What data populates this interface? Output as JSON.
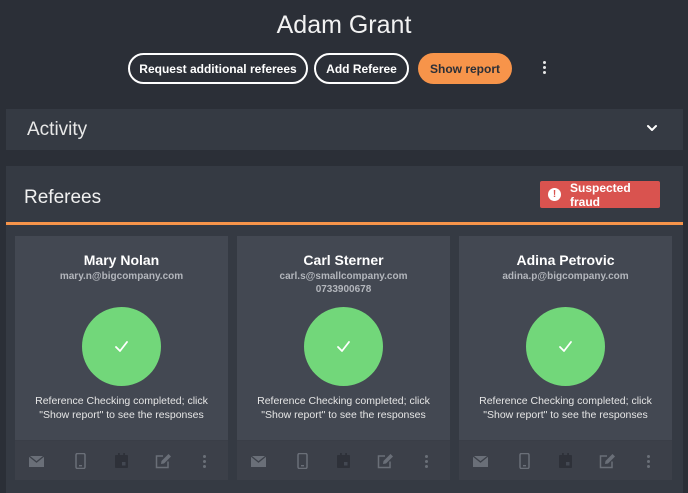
{
  "header": {
    "title": "Adam Grant",
    "buttons": {
      "request_label": "Request additional referees",
      "add_label": "Add Referee",
      "show_label": "Show report"
    },
    "more_icon": "more-vertical-icon"
  },
  "activity": {
    "title": "Activity",
    "toggle_icon": "chevron-down-icon"
  },
  "referees": {
    "title": "Referees",
    "badge": {
      "label": "Suspected fraud",
      "icon": "alert-circle-icon",
      "color": "#d9534f"
    },
    "accent_color": "#f7944a",
    "cards": [
      {
        "name": "Mary Nolan",
        "email": "mary.n@bigcompany.com",
        "phone": "",
        "status_line1": "Reference Checking completed; click",
        "status_line2": "\"Show report\" to see the responses"
      },
      {
        "name": "Carl Sterner",
        "email": "carl.s@smallcompany.com",
        "phone": "0733900678",
        "status_line1": "Reference Checking completed; click",
        "status_line2": "\"Show report\" to see the responses"
      },
      {
        "name": "Adina Petrovic",
        "email": "adina.p@bigcompany.com",
        "phone": "",
        "status_line1": "Reference Checking completed; click",
        "status_line2": "\"Show report\" to see the responses"
      }
    ],
    "footer_icons": [
      "mail-icon",
      "phone-icon",
      "calendar-icon",
      "edit-icon",
      "more-vertical-icon"
    ],
    "success_color": "#72d77a"
  }
}
